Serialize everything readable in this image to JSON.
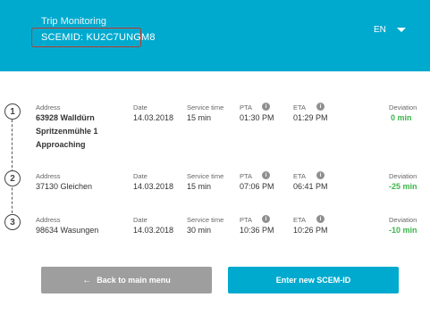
{
  "header": {
    "title": "Trip Monitoring",
    "scem_id": "SCEMID: KU2C7UNGM8",
    "language": "EN"
  },
  "columns": {
    "address": "Address",
    "date": "Date",
    "service_time": "Service time",
    "pta": "PTA",
    "eta": "ETA",
    "deviation": "Deviation"
  },
  "info_icon_glyph": "i",
  "stops": [
    {
      "number": "1",
      "address_line1": "63928 Walldürn",
      "address_line2": "Spritzenmühle 1",
      "status": "Approaching",
      "date": "14.03.2018",
      "service_time": "15 min",
      "pta": "01:30 PM",
      "eta": "01:29 PM",
      "deviation": "0 min"
    },
    {
      "number": "2",
      "address_line1": "37130 Gleichen",
      "date": "14.03.2018",
      "service_time": "15 min",
      "pta": "07:06 PM",
      "eta": "06:41 PM",
      "deviation": "-25 min"
    },
    {
      "number": "3",
      "address_line1": "98634 Wasungen",
      "date": "14.03.2018",
      "service_time": "30 min",
      "pta": "10:36 PM",
      "eta": "10:26 PM",
      "deviation": "-10 min"
    }
  ],
  "buttons": {
    "back_arrow": "←",
    "back_label": "Back to main menu",
    "new_label": "Enter new SCEM-ID"
  },
  "colors": {
    "header_bg": "#00aacf",
    "deviation": "#3cb54a",
    "back_button": "#9e9e9e",
    "highlight_box": "#c0392b"
  }
}
